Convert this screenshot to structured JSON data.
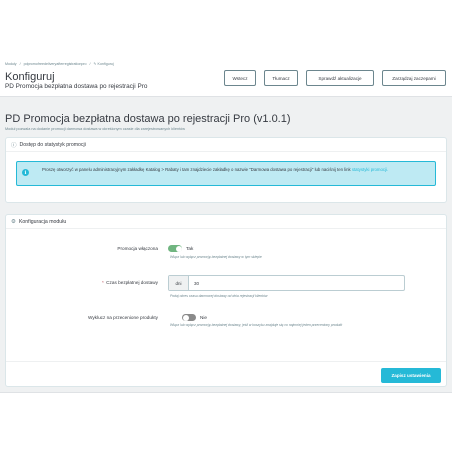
{
  "header": {
    "breadcrumb": [
      "Moduły",
      "/",
      "pdpromofreedeliveryafterregistrationpro",
      "/",
      "✎ Konfiguruj"
    ],
    "title": "Konfiguruj",
    "subtitle": "PD Promocja bezpłatna dostawa po rejestracji Pro",
    "toolbar": {
      "back": "Wstecz",
      "translate": "Tłumacz",
      "check_updates": "Sprawdź aktualizacje",
      "manage_hooks": "Zarządzaj zaczepami"
    }
  },
  "module": {
    "title": "PD Promocja bezpłatna dostawa po rejestracji Pro (v1.0.1)",
    "description": "Moduł pozwala na dodanie promocji darmowa dostawa w określonym czasie dla zarejestrowanych klientów"
  },
  "stats_panel": {
    "heading": "Dostęp do statystyk promocji",
    "icon": "info-icon",
    "alert_text": "Proszę otworzyć w panelu administracyjnym zakładkę Katalog > Rabaty i tam znajdziecie zakładkę o nazwie \"Darmowa dostawa po rejestracji\" lub naciśnij ten link ",
    "alert_link": "statystyki promocji.",
    "alert_icon": "info-circle-icon"
  },
  "config_panel": {
    "heading": "Konfiguracja modułu",
    "icon": "gears-icon",
    "fields": {
      "promo_enabled": {
        "label": "Promocja włączona",
        "state_label": "Tak",
        "help": "Włącz lub wyłącz promocję bezpłatnej dostawy w tym sklepie"
      },
      "free_time": {
        "required_mark": "*",
        "label": "Czas bezpłatnej dostawy",
        "prefix": "dni",
        "value": "30",
        "help": "Podaj okres czasu darmowej dostawy od dnia rejestracji klientów"
      },
      "exclude_discounted": {
        "label": "Wyklucz na przecenione produkty",
        "state_label": "Nie",
        "help": "Włącz lub wyłącz promocję bezpłatnej dostawy, jeśli w koszyku znajduje się co najmniej jeden przeceniony produkt"
      }
    },
    "save_label": "Zapisz ustawienia"
  },
  "colors": {
    "accent": "#25b9d7",
    "switch_on": "#70b580",
    "switch_off": "#8a8a8a",
    "alert_bg": "#beeaf3",
    "page_bg": "#eff1f2"
  }
}
